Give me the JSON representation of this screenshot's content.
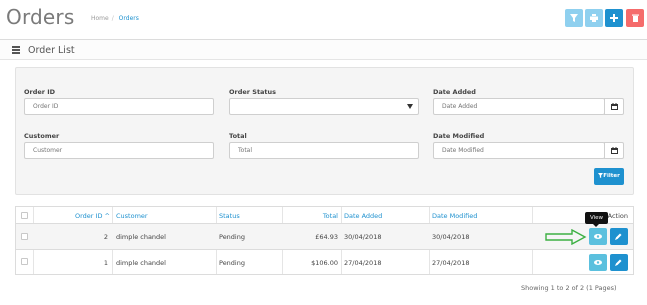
{
  "header": {
    "title": "Orders",
    "breadcrumb": [
      "Home",
      "Orders"
    ],
    "buttons": [
      {
        "icon": "filter-icon",
        "color": "#8fd0ef"
      },
      {
        "icon": "print-icon",
        "color": "#8fd0ef"
      },
      {
        "icon": "plus-icon",
        "color": "#1e91cf"
      },
      {
        "icon": "trash-icon",
        "color": "#f56b6b"
      }
    ]
  },
  "panel": {
    "title": "Order List"
  },
  "filter": {
    "order_id": {
      "label": "Order ID",
      "placeholder": "Order ID"
    },
    "order_status": {
      "label": "Order Status",
      "value": ""
    },
    "date_added": {
      "label": "Date Added",
      "placeholder": "Date Added"
    },
    "customer": {
      "label": "Customer",
      "placeholder": "Customer"
    },
    "total": {
      "label": "Total",
      "placeholder": "Total"
    },
    "date_modified": {
      "label": "Date Modified",
      "placeholder": "Date Modified"
    },
    "button_label": "Filter"
  },
  "table": {
    "columns": {
      "order_id": "Order ID",
      "customer": "Customer",
      "status": "Status",
      "total": "Total",
      "date_added": "Date Added",
      "date_modified": "Date Modified",
      "action": "Action"
    },
    "sort_indicator": "^",
    "rows": [
      {
        "order_id": "2",
        "customer": "dimple chandel",
        "status": "Pending",
        "total": "£64.93",
        "date_added": "30/04/2018",
        "date_modified": "30/04/2018"
      },
      {
        "order_id": "1",
        "customer": "dimple chandel",
        "status": "Pending",
        "total": "$106.00",
        "date_added": "27/04/2018",
        "date_modified": "27/04/2018"
      }
    ]
  },
  "tooltip": "View",
  "pagination": {
    "summary": "Showing 1 to 2 of 2 (1 Pages)"
  },
  "colors": {
    "primary": "#1e91cf",
    "info": "#5bc0de",
    "danger": "#f56b6b",
    "annotation_arrow": "#3cb043"
  }
}
